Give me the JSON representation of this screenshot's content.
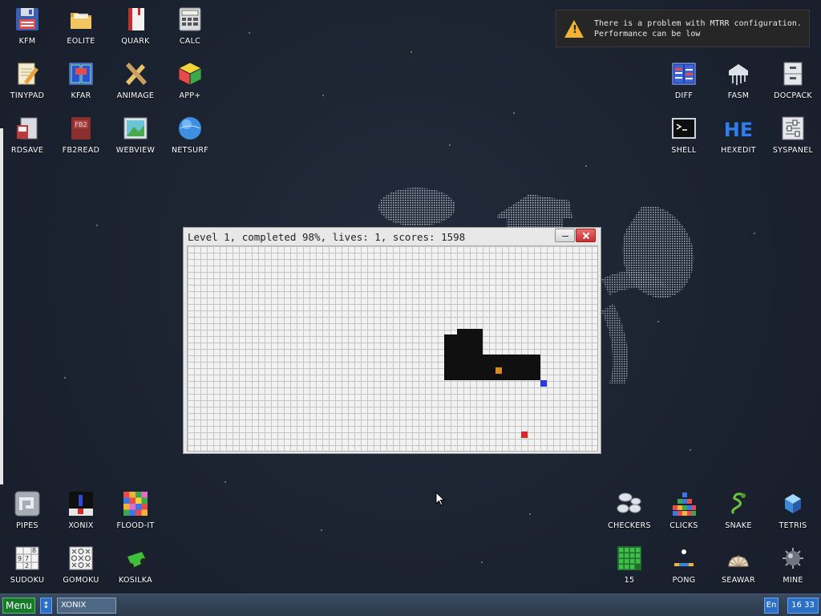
{
  "notification": {
    "line1": "There is a problem with MTRR configuration.",
    "line2": "Performance can be low"
  },
  "window": {
    "title": "Level 1, completed 98%, lives: 1, scores: 1598"
  },
  "icons": {
    "kfm": "KFM",
    "eolite": "EOLITE",
    "quark": "QUARK",
    "calc": "CALC",
    "tinypad": "TINYPAD",
    "kfar": "KFAR",
    "animage": "ANIMAGE",
    "app_plus": "APP+",
    "rdsave": "RDSAVE",
    "fb2read": "FB2READ",
    "webview": "WEBVIEW",
    "netsurf": "NETSURF",
    "diff": "DIFF",
    "fasm": "FASM",
    "docpack": "DOCPACK",
    "shell": "SHELL",
    "hexedit": "HEXEDIT",
    "syspanel": "SYSPANEL",
    "pipes": "PIPES",
    "xonix": "XONIX",
    "flood_it": "FLOOD-IT",
    "sudoku": "SUDOKU",
    "gomoku": "GOMOKU",
    "kosilka": "KOSILKA",
    "checkers": "CHECKERS",
    "clicks": "CLICKS",
    "snake": "SNAKE",
    "tetris": "TETRIS",
    "fifteen": "15",
    "pong": "PONG",
    "seawar": "SEAWAR",
    "mine": "MINE"
  },
  "taskbar": {
    "menu_label": "Menu",
    "swap_label": "↕",
    "task_label": "XONIX",
    "lang": "En",
    "time": "16 33"
  },
  "colors": {
    "desktop": "#1b2230",
    "menu_button": "#177a28",
    "taskbar_accent": "#2b6fc6",
    "warning": "#f2b233",
    "filled_area": "#101010"
  }
}
